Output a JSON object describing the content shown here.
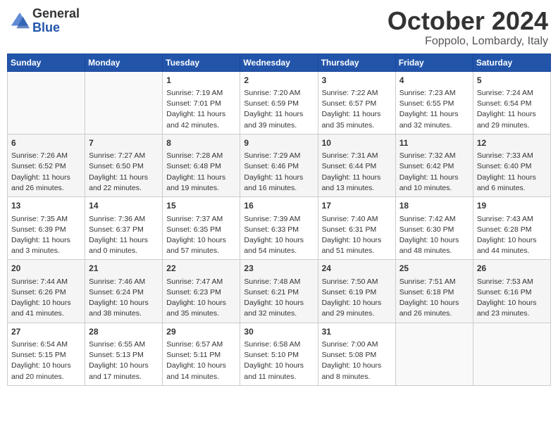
{
  "header": {
    "logo_line1": "General",
    "logo_line2": "Blue",
    "month": "October 2024",
    "location": "Foppolo, Lombardy, Italy"
  },
  "days_of_week": [
    "Sunday",
    "Monday",
    "Tuesday",
    "Wednesday",
    "Thursday",
    "Friday",
    "Saturday"
  ],
  "weeks": [
    [
      {
        "day": "",
        "info": ""
      },
      {
        "day": "",
        "info": ""
      },
      {
        "day": "1",
        "info": "Sunrise: 7:19 AM\nSunset: 7:01 PM\nDaylight: 11 hours and 42 minutes."
      },
      {
        "day": "2",
        "info": "Sunrise: 7:20 AM\nSunset: 6:59 PM\nDaylight: 11 hours and 39 minutes."
      },
      {
        "day": "3",
        "info": "Sunrise: 7:22 AM\nSunset: 6:57 PM\nDaylight: 11 hours and 35 minutes."
      },
      {
        "day": "4",
        "info": "Sunrise: 7:23 AM\nSunset: 6:55 PM\nDaylight: 11 hours and 32 minutes."
      },
      {
        "day": "5",
        "info": "Sunrise: 7:24 AM\nSunset: 6:54 PM\nDaylight: 11 hours and 29 minutes."
      }
    ],
    [
      {
        "day": "6",
        "info": "Sunrise: 7:26 AM\nSunset: 6:52 PM\nDaylight: 11 hours and 26 minutes."
      },
      {
        "day": "7",
        "info": "Sunrise: 7:27 AM\nSunset: 6:50 PM\nDaylight: 11 hours and 22 minutes."
      },
      {
        "day": "8",
        "info": "Sunrise: 7:28 AM\nSunset: 6:48 PM\nDaylight: 11 hours and 19 minutes."
      },
      {
        "day": "9",
        "info": "Sunrise: 7:29 AM\nSunset: 6:46 PM\nDaylight: 11 hours and 16 minutes."
      },
      {
        "day": "10",
        "info": "Sunrise: 7:31 AM\nSunset: 6:44 PM\nDaylight: 11 hours and 13 minutes."
      },
      {
        "day": "11",
        "info": "Sunrise: 7:32 AM\nSunset: 6:42 PM\nDaylight: 11 hours and 10 minutes."
      },
      {
        "day": "12",
        "info": "Sunrise: 7:33 AM\nSunset: 6:40 PM\nDaylight: 11 hours and 6 minutes."
      }
    ],
    [
      {
        "day": "13",
        "info": "Sunrise: 7:35 AM\nSunset: 6:39 PM\nDaylight: 11 hours and 3 minutes."
      },
      {
        "day": "14",
        "info": "Sunrise: 7:36 AM\nSunset: 6:37 PM\nDaylight: 11 hours and 0 minutes."
      },
      {
        "day": "15",
        "info": "Sunrise: 7:37 AM\nSunset: 6:35 PM\nDaylight: 10 hours and 57 minutes."
      },
      {
        "day": "16",
        "info": "Sunrise: 7:39 AM\nSunset: 6:33 PM\nDaylight: 10 hours and 54 minutes."
      },
      {
        "day": "17",
        "info": "Sunrise: 7:40 AM\nSunset: 6:31 PM\nDaylight: 10 hours and 51 minutes."
      },
      {
        "day": "18",
        "info": "Sunrise: 7:42 AM\nSunset: 6:30 PM\nDaylight: 10 hours and 48 minutes."
      },
      {
        "day": "19",
        "info": "Sunrise: 7:43 AM\nSunset: 6:28 PM\nDaylight: 10 hours and 44 minutes."
      }
    ],
    [
      {
        "day": "20",
        "info": "Sunrise: 7:44 AM\nSunset: 6:26 PM\nDaylight: 10 hours and 41 minutes."
      },
      {
        "day": "21",
        "info": "Sunrise: 7:46 AM\nSunset: 6:24 PM\nDaylight: 10 hours and 38 minutes."
      },
      {
        "day": "22",
        "info": "Sunrise: 7:47 AM\nSunset: 6:23 PM\nDaylight: 10 hours and 35 minutes."
      },
      {
        "day": "23",
        "info": "Sunrise: 7:48 AM\nSunset: 6:21 PM\nDaylight: 10 hours and 32 minutes."
      },
      {
        "day": "24",
        "info": "Sunrise: 7:50 AM\nSunset: 6:19 PM\nDaylight: 10 hours and 29 minutes."
      },
      {
        "day": "25",
        "info": "Sunrise: 7:51 AM\nSunset: 6:18 PM\nDaylight: 10 hours and 26 minutes."
      },
      {
        "day": "26",
        "info": "Sunrise: 7:53 AM\nSunset: 6:16 PM\nDaylight: 10 hours and 23 minutes."
      }
    ],
    [
      {
        "day": "27",
        "info": "Sunrise: 6:54 AM\nSunset: 5:15 PM\nDaylight: 10 hours and 20 minutes."
      },
      {
        "day": "28",
        "info": "Sunrise: 6:55 AM\nSunset: 5:13 PM\nDaylight: 10 hours and 17 minutes."
      },
      {
        "day": "29",
        "info": "Sunrise: 6:57 AM\nSunset: 5:11 PM\nDaylight: 10 hours and 14 minutes."
      },
      {
        "day": "30",
        "info": "Sunrise: 6:58 AM\nSunset: 5:10 PM\nDaylight: 10 hours and 11 minutes."
      },
      {
        "day": "31",
        "info": "Sunrise: 7:00 AM\nSunset: 5:08 PM\nDaylight: 10 hours and 8 minutes."
      },
      {
        "day": "",
        "info": ""
      },
      {
        "day": "",
        "info": ""
      }
    ]
  ]
}
